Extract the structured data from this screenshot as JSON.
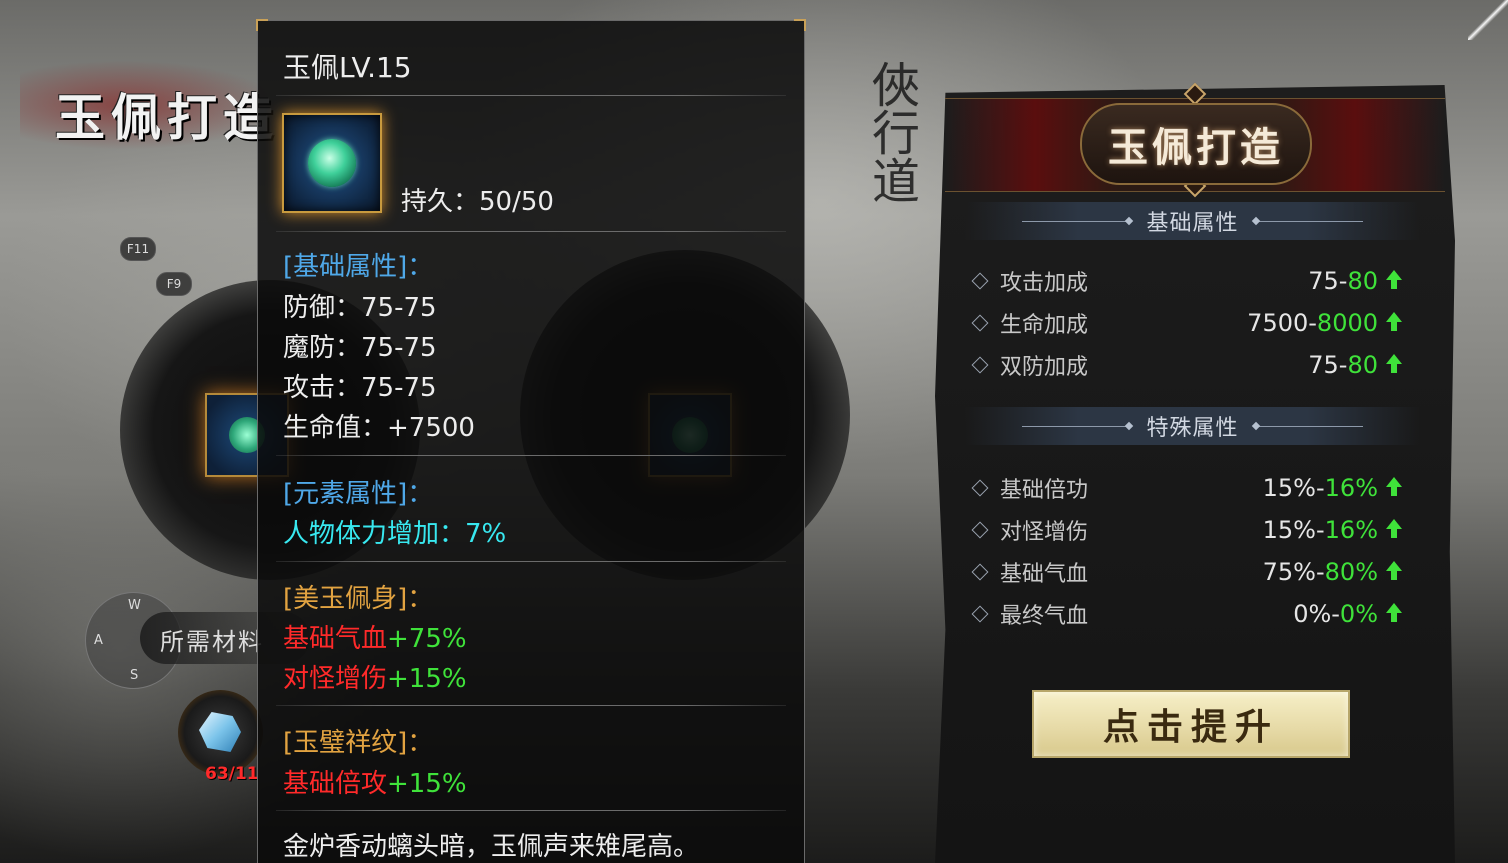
{
  "background": {
    "title": "玉佩打造",
    "hotkeys": [
      "F11",
      "F9"
    ],
    "compass": {
      "n": "W",
      "w": "A",
      "s": "S"
    },
    "materials_label": "所需材料",
    "material_count": "63/11"
  },
  "tooltip": {
    "title": "玉佩LV.15",
    "durability": "持久：50/50",
    "base_header": "[基础属性]：",
    "base_stats": [
      "防御：75-75",
      "魔防：75-75",
      "攻击：75-75",
      "生命值：+7500"
    ],
    "element_header": "[元素属性]：",
    "element_stat": "人物体力增加：7%",
    "set1_header": "[美玉佩身]：",
    "set1_stats": [
      {
        "name": "基础气血",
        "bonus": "+75%"
      },
      {
        "name": "对怪增伤",
        "bonus": "+15%"
      }
    ],
    "set2_header": "[玉璧祥纹]：",
    "set2_stats": [
      {
        "name": "基础倍攻",
        "bonus": "+15%"
      }
    ],
    "poem": "金炉香动螭头暗，玉佩声来雉尾高。"
  },
  "forge": {
    "title": "玉佩打造",
    "base_section": "基础属性",
    "base_rows": [
      {
        "name": "攻击加成",
        "current": "75-",
        "next": "80"
      },
      {
        "name": "生命加成",
        "current": "7500-",
        "next": "8000"
      },
      {
        "name": "双防加成",
        "current": "75-",
        "next": "80"
      }
    ],
    "special_section": "特殊属性",
    "special_rows": [
      {
        "name": "基础倍功",
        "current": "15%-",
        "next": "16%"
      },
      {
        "name": "对怪增伤",
        "current": "15%-",
        "next": "16%"
      },
      {
        "name": "基础气血",
        "current": "75%-",
        "next": "80%"
      },
      {
        "name": "最终气血",
        "current": "0%-",
        "next": "0%"
      }
    ],
    "upgrade_button": "点击提升"
  },
  "colors": {
    "stat_green": "#3fe23a",
    "set_red": "#ff2a2a",
    "header_blue": "#4fa8e8",
    "element_cyan": "#38e8f0",
    "set_gold": "#e2a341"
  }
}
